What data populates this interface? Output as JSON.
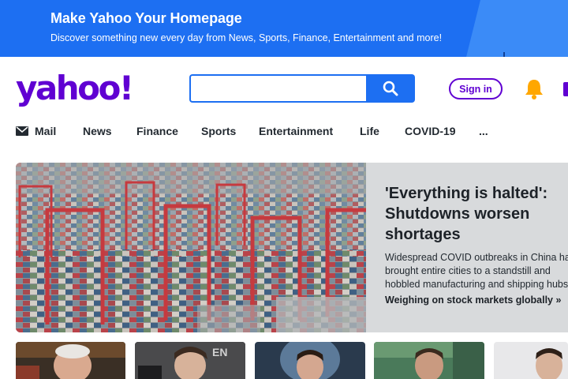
{
  "promo": {
    "title": "Make Yahoo Your Homepage",
    "subtitle": "Discover something new every day from News, Sports, Finance, Entertainment and more!"
  },
  "header": {
    "logo_text": "yahoo!",
    "search": {
      "value": "",
      "placeholder": ""
    },
    "sign_in_label": "Sign in"
  },
  "nav": {
    "items": [
      {
        "label": "Mail",
        "icon": "mail-icon"
      },
      {
        "label": "News"
      },
      {
        "label": "Finance"
      },
      {
        "label": "Sports"
      },
      {
        "label": "Entertainment"
      },
      {
        "label": "Life"
      },
      {
        "label": "COVID-19"
      },
      {
        "label": "..."
      }
    ]
  },
  "hero": {
    "title": "'Everything is halted': Shutdowns worsen shortages",
    "description_lines": [
      "Widespread COVID outbreaks in China have",
      "brought entire cities to a standstill and",
      "hobbled manufacturing and shipping hubs..."
    ],
    "link": "Weighing on stock markets globally »"
  },
  "colors": {
    "brand_purple": "#6001d2",
    "accent_blue": "#1d6ff2",
    "bell_yellow": "#ffa700"
  }
}
